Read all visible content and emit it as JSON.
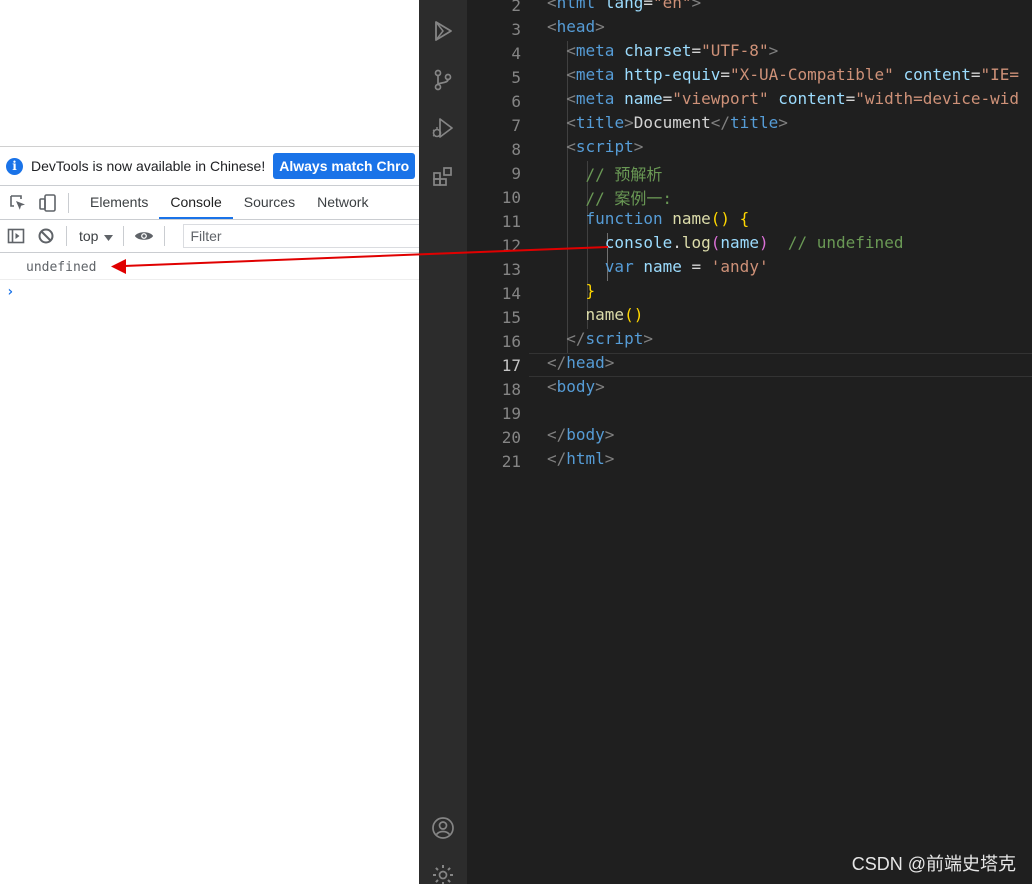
{
  "devtools": {
    "notification": {
      "text": "DevTools is now available in Chinese!",
      "button": "Always match Chro"
    },
    "tabs": [
      "Elements",
      "Console",
      "Sources",
      "Network"
    ],
    "active_tab": "Console",
    "context": "top",
    "filter_placeholder": "Filter",
    "console_output": "undefined",
    "prompt": "›"
  },
  "editor": {
    "line_numbers": [
      "2",
      "3",
      "4",
      "5",
      "6",
      "7",
      "8",
      "9",
      "10",
      "11",
      "12",
      "13",
      "14",
      "15",
      "16",
      "17",
      "18",
      "19",
      "20",
      "21"
    ],
    "current_line": "17",
    "lines": [
      [
        {
          "t": "<",
          "c": "br"
        },
        {
          "t": "html",
          "c": "tag"
        },
        {
          "t": " lang",
          "c": "attr"
        },
        {
          "t": "=",
          "c": "txt"
        },
        {
          "t": "\"en\"",
          "c": "str"
        },
        {
          "t": ">",
          "c": "br"
        }
      ],
      [
        {
          "t": "<",
          "c": "br"
        },
        {
          "t": "head",
          "c": "tag"
        },
        {
          "t": ">",
          "c": "br"
        }
      ],
      [
        {
          "t": "  <",
          "c": "br"
        },
        {
          "t": "meta",
          "c": "tag"
        },
        {
          "t": " charset",
          "c": "attr"
        },
        {
          "t": "=",
          "c": "txt"
        },
        {
          "t": "\"UTF-8\"",
          "c": "str"
        },
        {
          "t": ">",
          "c": "br"
        }
      ],
      [
        {
          "t": "  <",
          "c": "br"
        },
        {
          "t": "meta",
          "c": "tag"
        },
        {
          "t": " http-equiv",
          "c": "attr"
        },
        {
          "t": "=",
          "c": "txt"
        },
        {
          "t": "\"X-UA-Compatible\"",
          "c": "str"
        },
        {
          "t": " content",
          "c": "attr"
        },
        {
          "t": "=",
          "c": "txt"
        },
        {
          "t": "\"IE=",
          "c": "str"
        }
      ],
      [
        {
          "t": "  <",
          "c": "br"
        },
        {
          "t": "meta",
          "c": "tag"
        },
        {
          "t": " name",
          "c": "attr"
        },
        {
          "t": "=",
          "c": "txt"
        },
        {
          "t": "\"viewport\"",
          "c": "str"
        },
        {
          "t": " content",
          "c": "attr"
        },
        {
          "t": "=",
          "c": "txt"
        },
        {
          "t": "\"width=device-wid",
          "c": "str"
        }
      ],
      [
        {
          "t": "  <",
          "c": "br"
        },
        {
          "t": "title",
          "c": "tag"
        },
        {
          "t": ">",
          "c": "br"
        },
        {
          "t": "Document",
          "c": "txt"
        },
        {
          "t": "</",
          "c": "br"
        },
        {
          "t": "title",
          "c": "tag"
        },
        {
          "t": ">",
          "c": "br"
        }
      ],
      [
        {
          "t": "  <",
          "c": "br"
        },
        {
          "t": "script",
          "c": "tag"
        },
        {
          "t": ">",
          "c": "br"
        }
      ],
      [
        {
          "t": "    // 预解析",
          "c": "cmt"
        }
      ],
      [
        {
          "t": "    // 案例一:",
          "c": "cmt"
        }
      ],
      [
        {
          "t": "    function",
          "c": "kw"
        },
        {
          "t": " ",
          "c": "txt"
        },
        {
          "t": "name",
          "c": "fn"
        },
        {
          "t": "() {",
          "c": "p1"
        }
      ],
      [
        {
          "t": "      console",
          "c": "attr"
        },
        {
          "t": ".",
          "c": "txt"
        },
        {
          "t": "log",
          "c": "fn"
        },
        {
          "t": "(",
          "c": "p2"
        },
        {
          "t": "name",
          "c": "attr"
        },
        {
          "t": ")",
          "c": "p2"
        },
        {
          "t": "  // undefined",
          "c": "cmt"
        }
      ],
      [
        {
          "t": "      var",
          "c": "kw"
        },
        {
          "t": " ",
          "c": "txt"
        },
        {
          "t": "name",
          "c": "attr"
        },
        {
          "t": " = ",
          "c": "txt"
        },
        {
          "t": "'andy'",
          "c": "str"
        }
      ],
      [
        {
          "t": "    }",
          "c": "p1"
        }
      ],
      [
        {
          "t": "    name",
          "c": "fn"
        },
        {
          "t": "()",
          "c": "p1"
        }
      ],
      [
        {
          "t": "  </",
          "c": "br"
        },
        {
          "t": "script",
          "c": "tag"
        },
        {
          "t": ">",
          "c": "br"
        }
      ],
      [
        {
          "t": "</",
          "c": "br"
        },
        {
          "t": "head",
          "c": "tag"
        },
        {
          "t": ">",
          "c": "br"
        }
      ],
      [
        {
          "t": "<",
          "c": "br"
        },
        {
          "t": "body",
          "c": "tag"
        },
        {
          "t": ">",
          "c": "br"
        }
      ],
      [],
      [
        {
          "t": "</",
          "c": "br"
        },
        {
          "t": "body",
          "c": "tag"
        },
        {
          "t": ">",
          "c": "br"
        }
      ],
      [
        {
          "t": "</",
          "c": "br"
        },
        {
          "t": "html",
          "c": "tag"
        },
        {
          "t": ">",
          "c": "br"
        }
      ]
    ]
  },
  "watermark": "CSDN @前端史塔克",
  "colors": {
    "devtools_accent": "#1a73e8",
    "editor_bg": "#1f1f1f",
    "activity_bar_bg": "#2c2c2c",
    "arrow": "#e00000"
  },
  "icons": [
    "inspect-element-icon",
    "device-toggle-icon",
    "sidebar-toggle-icon",
    "clear-console-icon",
    "context-dropdown-icon",
    "eye-icon",
    "explorer-icon",
    "source-control-icon",
    "run-debug-icon",
    "extensions-icon",
    "account-icon",
    "settings-gear-icon"
  ]
}
